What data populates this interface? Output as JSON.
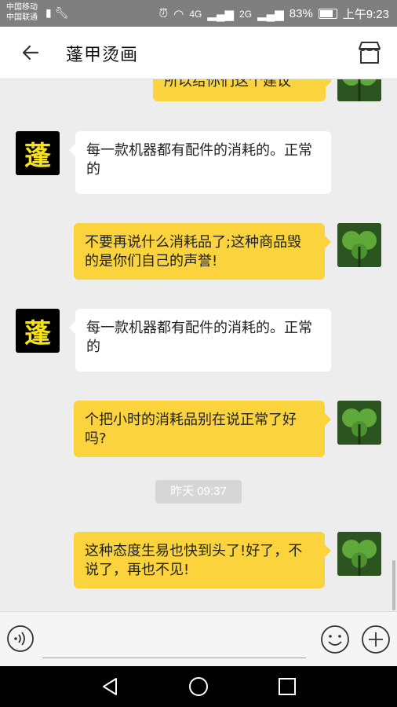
{
  "status_bar": {
    "carrier1": "中国移动",
    "carrier2": "中国联通",
    "network1": "4G",
    "network2": "2G",
    "battery": "83%",
    "time": "上午9:23"
  },
  "header": {
    "title": "蓬甲烫画"
  },
  "shop_avatar_text": "蓬",
  "messages": [
    {
      "side": "out",
      "text": "所以给你们这个建议"
    },
    {
      "side": "in",
      "text": "每一款机器都有配件的消耗的。正常的"
    },
    {
      "side": "out",
      "text": "不要再说什么消耗品了;这种商品毁的是你们自己的声誉!"
    },
    {
      "side": "in",
      "text": "每一款机器都有配件的消耗的。正常的"
    },
    {
      "side": "out",
      "text": "个把小时的消耗品别在说正常了好吗?"
    },
    {
      "side": "out",
      "text": "这种态度生易也快到头了!好了，不说了，再也不见!"
    }
  ],
  "timestamp": "昨天 09:37",
  "colors": {
    "out_bubble": "#fbd33d",
    "in_bubble": "#ffffff",
    "background": "#ededed"
  }
}
